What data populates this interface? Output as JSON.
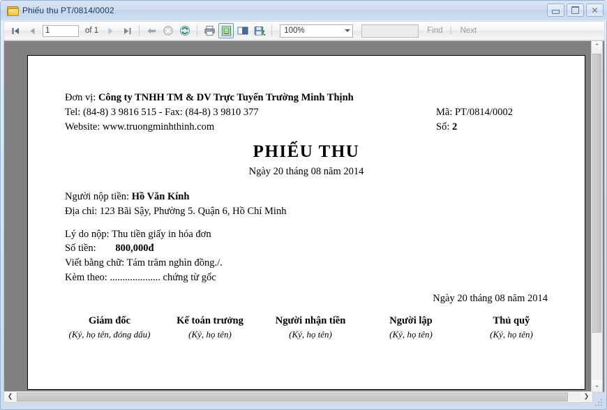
{
  "window": {
    "title": "Phiếu thu PT/0814/0002",
    "icon": "folder-icon",
    "minimize_label": "",
    "maximize_label": "",
    "close_label": "✕"
  },
  "toolbar": {
    "first_page_icon": "first-page-icon",
    "prev_page_icon": "previous-page-icon",
    "page_number": "1",
    "of_label": "of 1",
    "next_page_icon": "next-page-icon",
    "last_page_icon": "last-page-icon",
    "back_icon": "back-arrow-icon",
    "stop_icon": "stop-icon",
    "refresh_icon": "refresh-icon",
    "print_icon": "print-icon",
    "print_layout_icon": "print-layout-icon",
    "page_setup_icon": "page-setup-icon",
    "export_icon": "export-save-icon",
    "zoom_value": "100%",
    "search_value": "",
    "find_label": "Find",
    "separator_label": "|",
    "next_label": "Next"
  },
  "report": {
    "company_label": "Đơn vị:",
    "company_name": "Công ty TNHH TM & DV Trực Tuyến Trường Minh Thịnh",
    "contact": "Tel: (84-8) 3 9816 515 - Fax: (84-8) 3 9810 377",
    "website": "Website: www.truongminhthinh.com",
    "code_label": "Mã:",
    "code_value": "PT/0814/0002",
    "number_label": "Số:",
    "number_value": "2",
    "title": "PHIẾU THU",
    "date": "Ngày 20 tháng 08 năm 2014",
    "payer_label": "Người nộp tiền:",
    "payer_name": "Hồ Văn Kính",
    "address": "Địa chỉ: 123 Bãi Sậy, Phường 5. Quận 6, Hồ Chí Minh",
    "reason": "Lý do nộp: Thu tiền giấy in hóa đơn",
    "amount_label": "Số tiền:",
    "amount_value": "800,000đ",
    "in_words": "Viết bằng chữ: Tám trăm nghìn đồng./.",
    "attachment": "Kèm theo: .................... chứng từ gốc",
    "sign_date": "Ngày 20 tháng 08 năm 2014",
    "signatures": [
      {
        "title": "Giám đốc",
        "sub": "(Ký, họ tên, đóng dấu)"
      },
      {
        "title": "Kế toán trưởng",
        "sub": "(Ký, họ tên)"
      },
      {
        "title": "Người nhận tiền",
        "sub": "(Ký, họ tên)"
      },
      {
        "title": "Người lập",
        "sub": "(Ký, họ tên)"
      },
      {
        "title": "Thủ quỹ",
        "sub": "(Ký, họ tên)"
      }
    ]
  },
  "scrollbars": {
    "up_arrow": "⌃",
    "down_arrow": "⌄",
    "left_arrow": "❮",
    "right_arrow": "❯"
  }
}
